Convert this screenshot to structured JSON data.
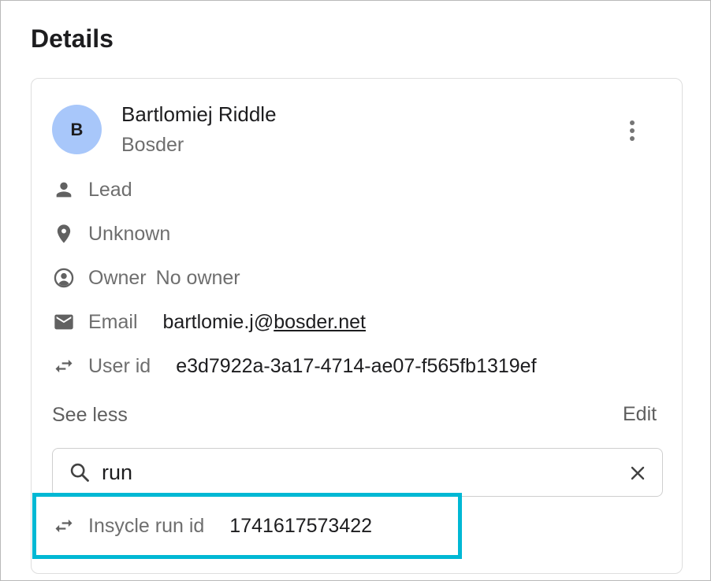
{
  "section_title": "Details",
  "contact": {
    "avatar_initial": "B",
    "name": "Bartlomiej Riddle",
    "company": "Bosder"
  },
  "fields": {
    "status": "Lead",
    "location": "Unknown",
    "owner_label": "Owner",
    "owner_value": "No owner",
    "email_label": "Email",
    "email_value": "bartlomie.j@bosder.net",
    "user_id_label": "User id",
    "user_id_value": "e3d7922a-3a17-4714-ae07-f565fb1319ef"
  },
  "actions": {
    "see_less": "See less",
    "edit": "Edit"
  },
  "search": {
    "value": "run"
  },
  "result": {
    "label": "Insycle run id",
    "value": "1741617573422"
  },
  "colors": {
    "avatar_bg": "#a8c7fa",
    "highlight_border": "#00b8d4",
    "icon": "#616161"
  },
  "icons": [
    "person-icon",
    "location-pin-icon",
    "account-circle-icon",
    "mail-icon",
    "swap-arrows-icon",
    "search-icon",
    "close-icon",
    "more-vert-icon"
  ]
}
